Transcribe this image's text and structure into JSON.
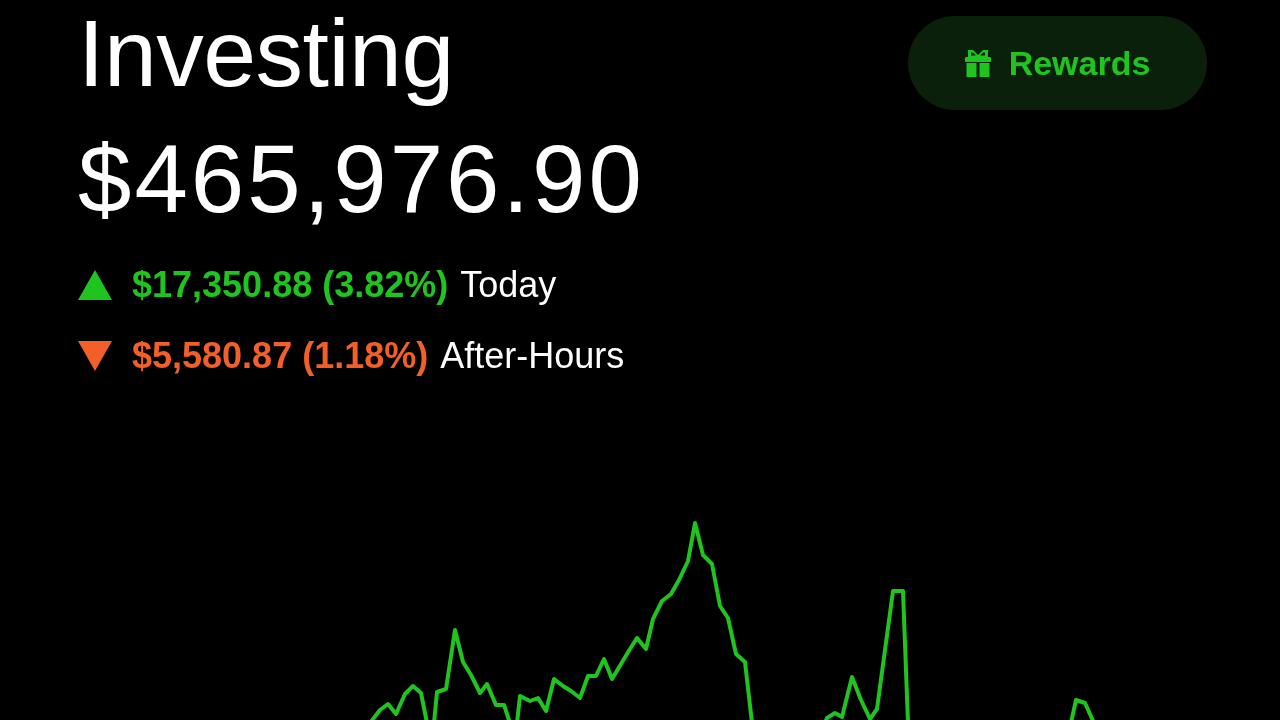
{
  "header": {
    "title": "Investing",
    "rewards_button": {
      "label": "Rewards"
    }
  },
  "portfolio": {
    "value": "$465,976.90",
    "changes": [
      {
        "kind": "gain",
        "amount": "$17,350.88 (3.82%)",
        "period": "Today"
      },
      {
        "kind": "loss",
        "amount": "$5,580.87 (1.18%)",
        "period": "After-Hours"
      }
    ]
  }
}
